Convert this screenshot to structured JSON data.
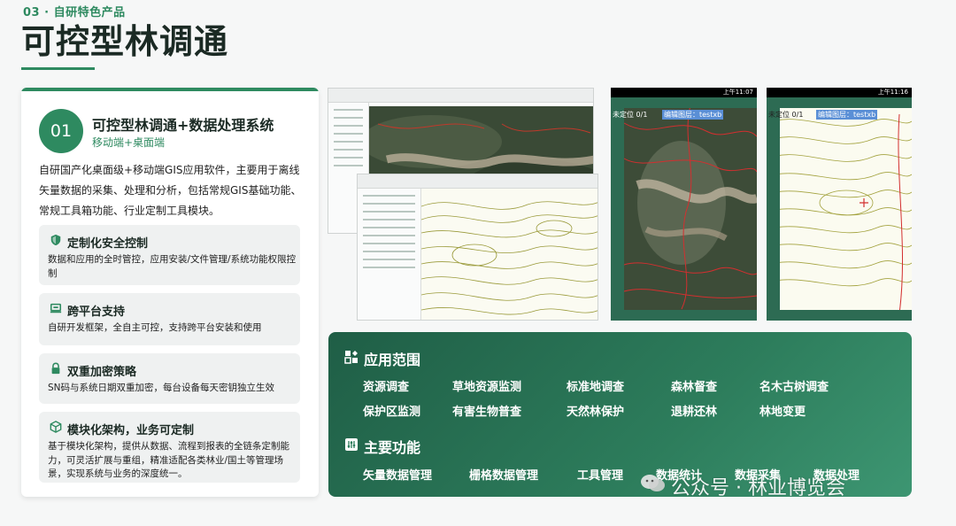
{
  "header": {
    "section_tag": "03 · 自研特色产品",
    "title": "可控型林调通"
  },
  "product": {
    "number": "01",
    "title": "可控型林调通+数据处理系统",
    "subtitle": "移动端+桌面端",
    "description": "自研国产化桌面级+移动端GIS应用软件，主要用于离线矢量数据的采集、处理和分析，包括常规GIS基础功能、常规工具箱功能、行业定制工具模块。"
  },
  "features": [
    {
      "icon": "shield-icon",
      "title": "定制化安全控制",
      "desc": "数据和应用的全时管控，应用安装/文件管理/系统功能权限控制"
    },
    {
      "icon": "laptop-icon",
      "title": "跨平台支持",
      "desc": "自研开发框架，全自主可控，支持跨平台安装和使用"
    },
    {
      "icon": "lock-icon",
      "title": "双重加密策略",
      "desc": "SN码与系统日期双重加密，每台设备每天密钥独立生效"
    },
    {
      "icon": "cube-icon",
      "title": "模块化架构，业务可定制",
      "desc": "基于模块化架构，提供从数据、流程到报表的全链条定制能力，可灵活扩展与重组，精准适配各类林业/国土等管理场景，实现系统与业务的深度统一。"
    }
  ],
  "screens": {
    "phone1_status": "上午11:07",
    "phone1_location": "未定位 0/1",
    "phone1_layer": "编辑图层：testxb",
    "phone2_status": "上午11:16",
    "phone2_location": "未定位 0/1",
    "phone2_layer": "编辑图层：testxb"
  },
  "panel": {
    "scope_title": "应用范围",
    "scope_items": [
      "资源调查",
      "草地资源监测",
      "标准地调查",
      "森林督查",
      "名木古树调查",
      "保护区监测",
      "有害生物普查",
      "天然林保护",
      "退耕还林",
      "林地变更"
    ],
    "func_title": "主要功能",
    "func_items": [
      "矢量数据管理",
      "栅格数据管理",
      "工具管理",
      "数据统计",
      "数据采集",
      "数据处理"
    ],
    "watermark": "公众号 · 林业博览会"
  },
  "colors": {
    "accent": "#2e8a60",
    "panel_dark": "#1f5e46",
    "panel_light": "#3d9672"
  }
}
